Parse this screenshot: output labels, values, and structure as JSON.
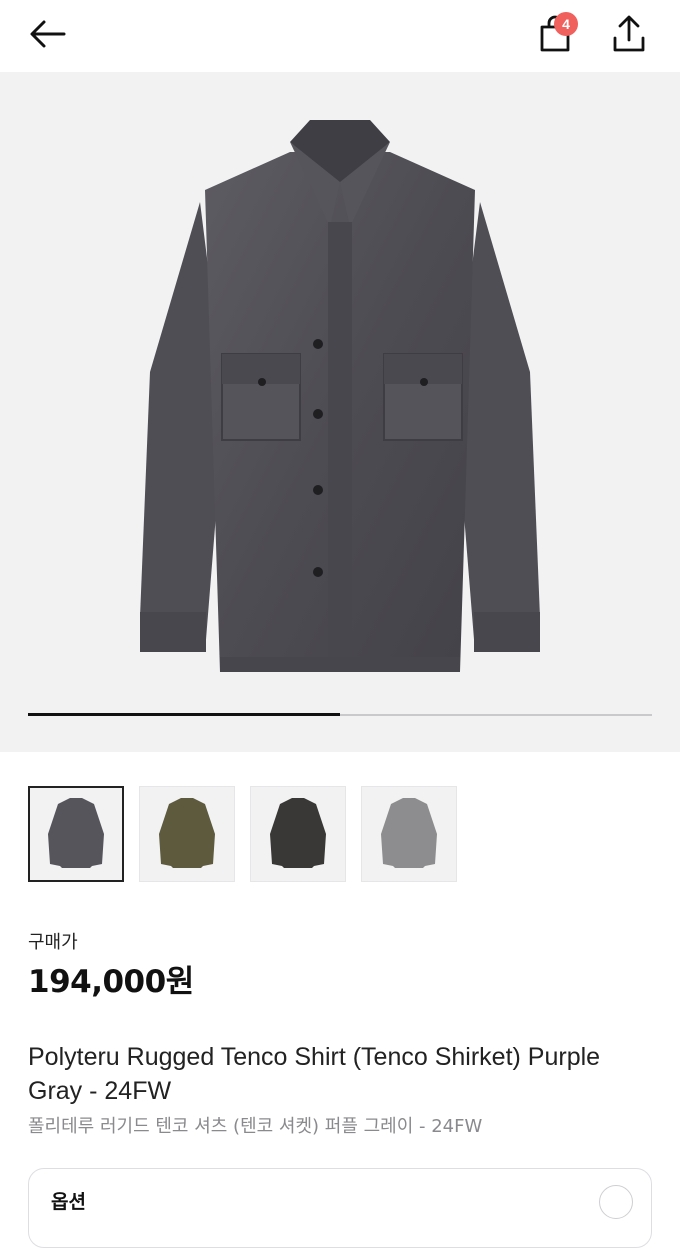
{
  "header": {
    "back_icon": "arrow-left-icon",
    "cart_icon": "shopping-bag-icon",
    "cart_badge": "4",
    "share_icon": "share-icon",
    "badge_color": "#f0605c"
  },
  "gallery": {
    "current_image": "purple-gray-shirt",
    "progress_fraction": 0.5
  },
  "thumbnails": [
    {
      "color_name": "purple-gray",
      "color": "#55555b",
      "selected": true
    },
    {
      "color_name": "olive",
      "color": "#5e5a3e",
      "selected": false
    },
    {
      "color_name": "black",
      "color": "#3a3836",
      "selected": false
    },
    {
      "color_name": "light-gray",
      "color": "#8d8d8f",
      "selected": false
    }
  ],
  "product": {
    "price_label": "구매가",
    "price": "194,000원",
    "title_en": "Polyteru Rugged Tenco Shirt (Tenco Shirket) Purple Gray - 24FW",
    "title_ko": "폴리테루 러기드 텐코 셔츠 (텐코 셔켓) 퍼플 그레이 - 24FW"
  },
  "option": {
    "label": "옵션"
  }
}
